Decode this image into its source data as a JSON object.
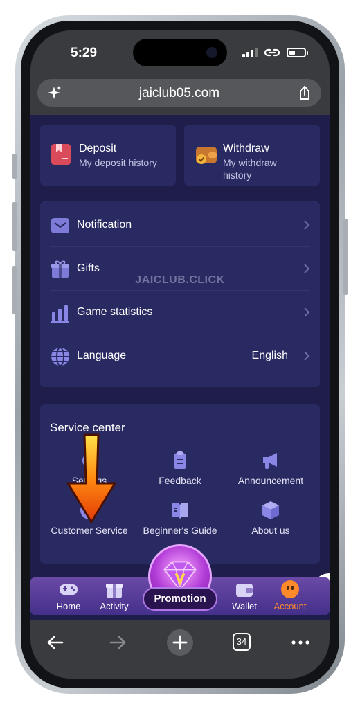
{
  "status_bar": {
    "time": "5:29"
  },
  "browser": {
    "url": "jaiclub05.com",
    "tab_count": "34"
  },
  "wallet_actions": [
    {
      "title": "Deposit",
      "subtitle": "My deposit history"
    },
    {
      "title": "Withdraw",
      "subtitle": "My withdraw history"
    }
  ],
  "menu": {
    "items": [
      {
        "label": "Notification",
        "value": ""
      },
      {
        "label": "Gifts",
        "value": ""
      },
      {
        "label": "Game statistics",
        "value": ""
      },
      {
        "label": "Language",
        "value": "English"
      }
    ]
  },
  "watermark": "JAICLUB.CLICK",
  "service_center": {
    "title": "Service center",
    "items": [
      {
        "label": "Settings",
        "icon": "gear-icon"
      },
      {
        "label": "Feedback",
        "icon": "clipboard-icon"
      },
      {
        "label": "Announcement",
        "icon": "megaphone-icon"
      },
      {
        "label": "Customer Service",
        "icon": "headset-icon"
      },
      {
        "label": "Beginner's Guide",
        "icon": "book-icon"
      },
      {
        "label": "About us",
        "icon": "cube-icon"
      }
    ]
  },
  "tabbar": {
    "home": "Home",
    "activity": "Activity",
    "promotion": "Promotion",
    "wallet": "Wallet",
    "account": "Account"
  },
  "colors": {
    "page_bg": "#1f1d4a",
    "card_bg": "#2a2a62",
    "accent_orange": "#ff8a2a",
    "icon_purple": "#8a86e6"
  }
}
